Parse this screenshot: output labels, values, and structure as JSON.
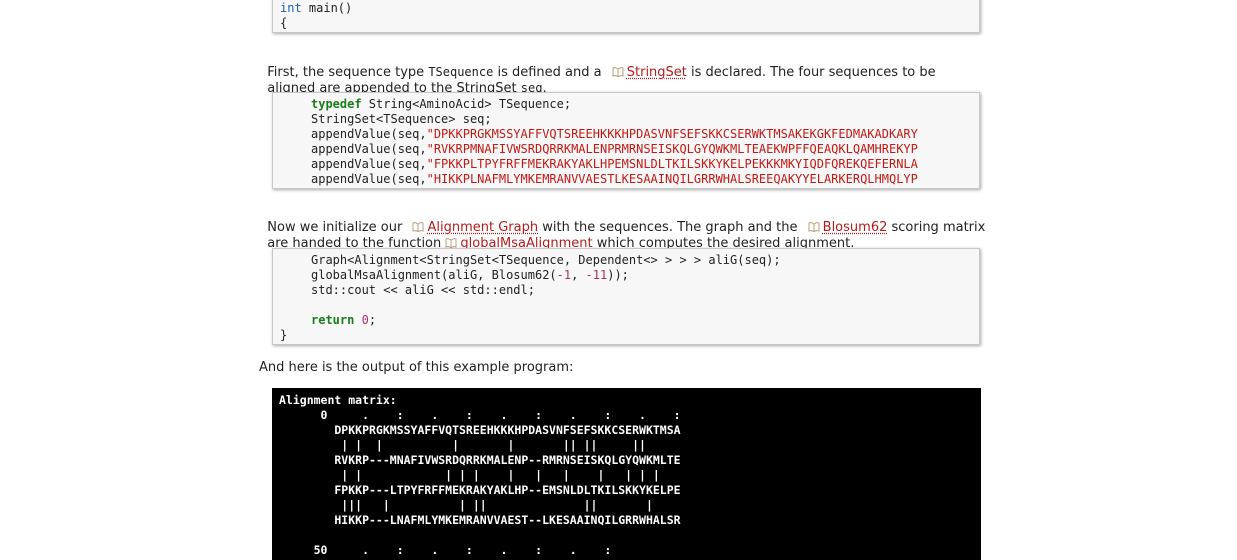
{
  "code_top": {
    "lines": [
      "int main()",
      "{"
    ]
  },
  "para1": {
    "a": "First, the sequence type ",
    "b": "TSequence",
    "c": " is defined and a ",
    "link": "StringSet",
    "d": " is declared. The four sequences to be",
    "line2a": "aligned are appended to the StringSet ",
    "line2b": "seq",
    "line2c": "."
  },
  "code_mid": {
    "l1_kw": "typedef",
    "l1_rest": " String<AminoAcid> TSequence;",
    "l2": "StringSet<TSequence> seq;",
    "appends": [
      {
        "pre": "appendValue(seq,",
        "str": "\"DPKKPRGKMSSYAFFVQTSREEHKKKHPDASVNFSEFSKKCSERWKTMSAKEKGKFEDMAKADKARY"
      },
      {
        "pre": "appendValue(seq,",
        "str": "\"RVKRPMNAFIVWSRDQRRKMALENPRMRNSEISKQLGYQWKMLTEAEKWPFFQEAQKLQAMHREKYP"
      },
      {
        "pre": "appendValue(seq,",
        "str": "\"FPKKPLTPYFRFFMEKRAKYAKLHPEMSNLDLTKILSKKYKELPEKKKMKYIQDFQREKQEFERNLA"
      },
      {
        "pre": "appendValue(seq,",
        "str": "\"HIKKPLNAFMLYMKEMRANVVAESTLKESAAINQILGRRWHALSREEQAKYYELARKERQLHMQLYP"
      }
    ]
  },
  "para2": {
    "a": "Now we initialize our ",
    "link1": "Alignment Graph",
    "b": " with the sequences. The graph and the ",
    "link2": "Blosum62",
    "c": " scoring matrix",
    "line2a": "are handed to the function ",
    "link3": "globalMsaAlignment",
    "line2b": " which computes the desired alignment."
  },
  "code_bottom": {
    "l1": "Graph<Alignment<StringSet<TSequence, Dependent<> > > > aliG(seq);",
    "l2a": "globalMsaAlignment(aliG, Blosum62(",
    "l2n1": "-1",
    "l2b": ", ",
    "l2n2": "-11",
    "l2c": "));",
    "l3": "std::cout << aliG << std::endl;",
    "ret_kw": "return",
    "ret_num": "0",
    "ret_end": ";",
    "close": "}"
  },
  "para3": {
    "text": "And here is the output of this example program:"
  },
  "terminal": {
    "lines": [
      "Alignment matrix:",
      "      0     .    :    .    :    .    :    .    :    .    :",
      "        DPKKPRGKMSSYAFFVQTSREEHKKKHPDASVNFSEFSKKCSERWKTMSA",
      "         | |  |          |       |       || ||     ||",
      "        RVKRP---MNAFIVWSRDQRRKMALENP--RMRNSEISKQLGYQWKMLTE",
      "         | |            | | |    |   |   |    |   | | |",
      "        FPKKP---LTPYFRFFMEKRAKYAKLHP--EMSNLDLTKILSKKYKELPE",
      "         |||   |          | ||              ||       |",
      "        HIKKP---LNAFMLYMKEMRANVVAEST--LKESAAINQILGRRWHALSR",
      "",
      "     50     .    :    .    :    .    :    .    :"
    ]
  }
}
